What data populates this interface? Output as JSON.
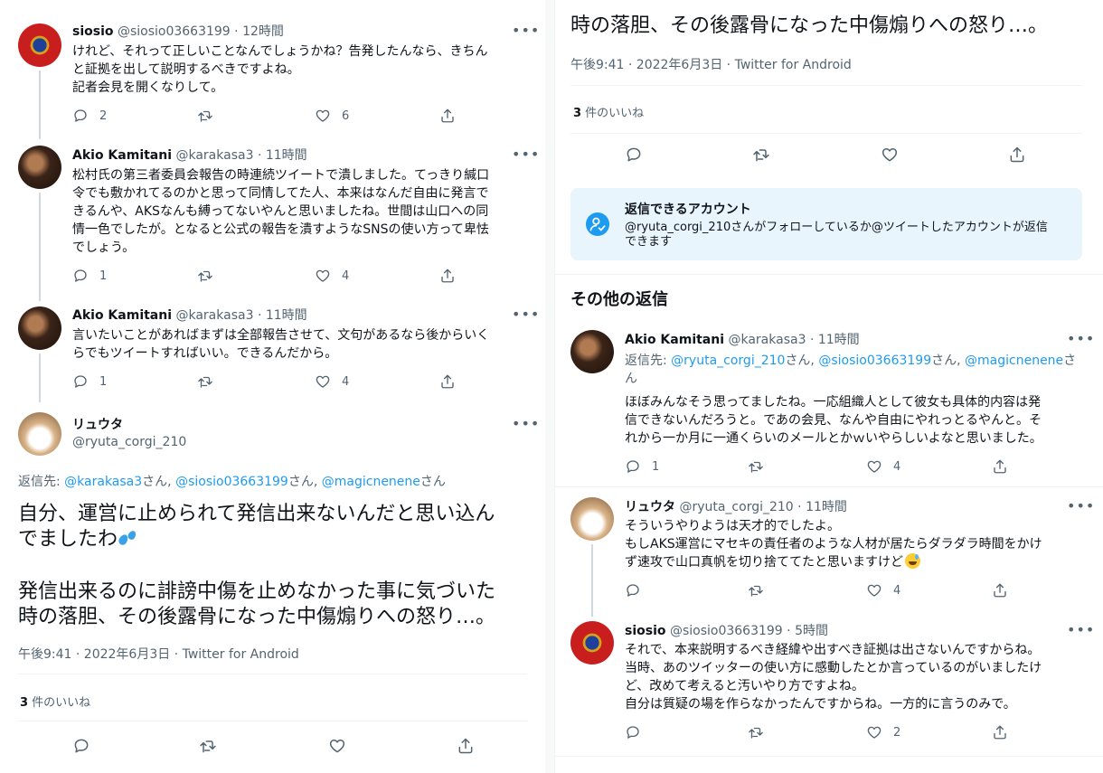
{
  "left": {
    "tweets": [
      {
        "name": "siosio",
        "handle": "@siosio03663199",
        "time": "· 12時間",
        "text": "けれど、それって正しいことなんでしょうかね？告発したんなら、きちん\nと証拠を出して説明するべきですよね。\n記者会見を開くなりして。",
        "reply": "2",
        "retweet": "",
        "like": "6"
      },
      {
        "name": "Akio Kamitani",
        "handle": "@karakasa3",
        "time": "· 11時間",
        "text": "松村氏の第三者委員会報告の時連続ツイートで潰しました。てっきり緘口\n令でも敷かれてるのかと思って同情してた人、本来はなんだ自由に発言で\nきるんや、AKSなんも縛ってないやんと思いましたね。世間は山口への同\n情一色でしたが。となると公式の報告を潰すようなSNSの使い方って卑怯\nでしょう。",
        "reply": "1",
        "retweet": "",
        "like": "4"
      },
      {
        "name": "Akio Kamitani",
        "handle": "@karakasa3",
        "time": "· 11時間",
        "text": "言いたいことがあればまずは全部報告させて、文句があるなら後からいく\nらでもツイートすればいい。できるんだから。",
        "reply": "1",
        "retweet": "",
        "like": "4"
      }
    ],
    "main": {
      "name": "リュウタ",
      "handle": "@ryuta_corgi_210",
      "reply_to_prefix": "返信先: ",
      "reply_to_1": "@karakasa3",
      "reply_to_san1": "さん, ",
      "reply_to_2": "@siosio03663199",
      "reply_to_san2": "さん, ",
      "reply_to_3": "@magicnenene",
      "reply_to_san3": "さん",
      "text_1": "自分、運営に止められて発信出来ないんだと思い込ん\nでましたわ",
      "text_2": "発信出来るのに誹謗中傷を止めなかった事に気づいた\n時の落胆、その後露骨になった中傷煽りへの怒り…。",
      "meta": "午後9:41 · 2022年6月3日 · Twitter for Android",
      "likes_count": "3",
      "likes_label": " 件のいいね"
    }
  },
  "right": {
    "top_text": "時の落胆、その後露骨になった中傷煽りへの怒り…。",
    "meta": "午後9:41 · 2022年6月3日 · Twitter for Android",
    "likes_count": "3",
    "likes_label": " 件のいいね",
    "notice": {
      "title": "返信できるアカウント",
      "body": "@ryuta_corgi_210さんがフォローしているか@ツイートしたアカウントが返信\nできます"
    },
    "section_title": "その他の返信",
    "replies": [
      {
        "name": "Akio Kamitani",
        "handle": "@karakasa3",
        "time": "· 11時間",
        "reply_prefix": "返信先: ",
        "reply_1": "@ryuta_corgi_210",
        "reply_san1": "さん, ",
        "reply_2": "@siosio03663199",
        "reply_san2": "さん, ",
        "reply_3": "@magicnenene",
        "reply_san3": "さ",
        "reply_tail": "ん",
        "text": "ほぼみんなそう思ってましたね。一応組織人として彼女も具体的内容は発\n信できないんだろうと。であの会見、なんや自由にやれっとるやんと。そ\nれから一か月に一通くらいのメールとかｗいやらしいよなと思いました。",
        "reply": "1",
        "like": "4"
      },
      {
        "name": "リュウタ",
        "handle": "@ryuta_corgi_210",
        "time": "· 11時間",
        "text": "そういうやりようは天才的でしたよ。\nもしAKS運営にマセキの責任者のような人材が居たらダラダラ時間をかけ\nず速攻で山口真帆を切り捨ててたと思いますけど",
        "reply": "",
        "like": "4"
      },
      {
        "name": "siosio",
        "handle": "@siosio03663199",
        "time": "· 5時間",
        "text": "それで、本来説明するべき経緯や出すべき証拠は出さないんですからね。\n当時、あのツイッターの使い方に感動したとか言っているのがいましたけ\nど、改めて考えると汚いやり方ですよね。\n自分は質疑の場を作らなかったんですからね。一方的に言うのみで。",
        "reply": "",
        "like": "2"
      }
    ]
  },
  "colors": {
    "link": "#1d9bf0",
    "muted": "#536471",
    "notice_bg": "#e8f5fd",
    "notice_icon": "#1d9bf0"
  },
  "icons": {
    "reply": "reply-icon",
    "retweet": "retweet-icon",
    "like": "heart-icon",
    "share": "share-icon",
    "more": "more-icon"
  }
}
